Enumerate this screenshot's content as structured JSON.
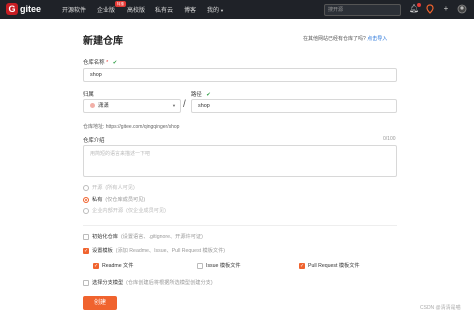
{
  "topbar": {
    "logo_text": "gitee",
    "logo_letter": "G",
    "nav": [
      "开源软件",
      "企业版",
      "高校版",
      "私有云",
      "博客",
      "我的"
    ],
    "badge": "特惠",
    "search_placeholder": "搜开源"
  },
  "page": {
    "title": "新建仓库",
    "import_question": "在其他网站已经有仓库了吗?",
    "import_link": "点击导入"
  },
  "form": {
    "repo_name_label": "仓库名称",
    "repo_name_required": "*",
    "repo_name_value": "shop",
    "owner_label": "归属",
    "owner_value": "潇潇",
    "path_label": "路径",
    "path_value": "shop",
    "repo_url_label": "仓库地址:",
    "repo_url_value": "https://gitee.com/qingqinger/shop",
    "desc_label": "仓库介绍",
    "desc_counter": "0/100",
    "desc_placeholder": "用简短的语言来描述一下吧",
    "visibility": [
      {
        "label": "开源",
        "note": "(所有人可见)",
        "selected": false,
        "disabled": true
      },
      {
        "label": "私有",
        "note": "(仅仓库成员可见)",
        "selected": true,
        "disabled": false
      },
      {
        "label": "企业内部开源",
        "note": "(仅企业成员可见)",
        "selected": false,
        "disabled": true
      }
    ],
    "init_repo": {
      "label": "初始化仓库",
      "note": "(设置语言、.gitignore、开源许可证)",
      "checked": false
    },
    "set_template": {
      "label": "设置模板",
      "note": "(添加 Readme、Issue、Pull Request 模板文件)",
      "checked": true
    },
    "templates": [
      {
        "label": "Readme 文件",
        "checked": true
      },
      {
        "label": "Issue 模板文件",
        "checked": false
      },
      {
        "label": "Pull Request 模板文件",
        "checked": true
      }
    ],
    "branch_model": {
      "label": "选择分支模型",
      "note": "(仓库创建后将根据所选模型创建分支)",
      "checked": false
    },
    "create_button": "创建"
  },
  "watermark": "CSDN @清清是喵",
  "colors": {
    "accent": "#f0632e",
    "topbar": "#1f2228",
    "brand": "#c71d23"
  }
}
